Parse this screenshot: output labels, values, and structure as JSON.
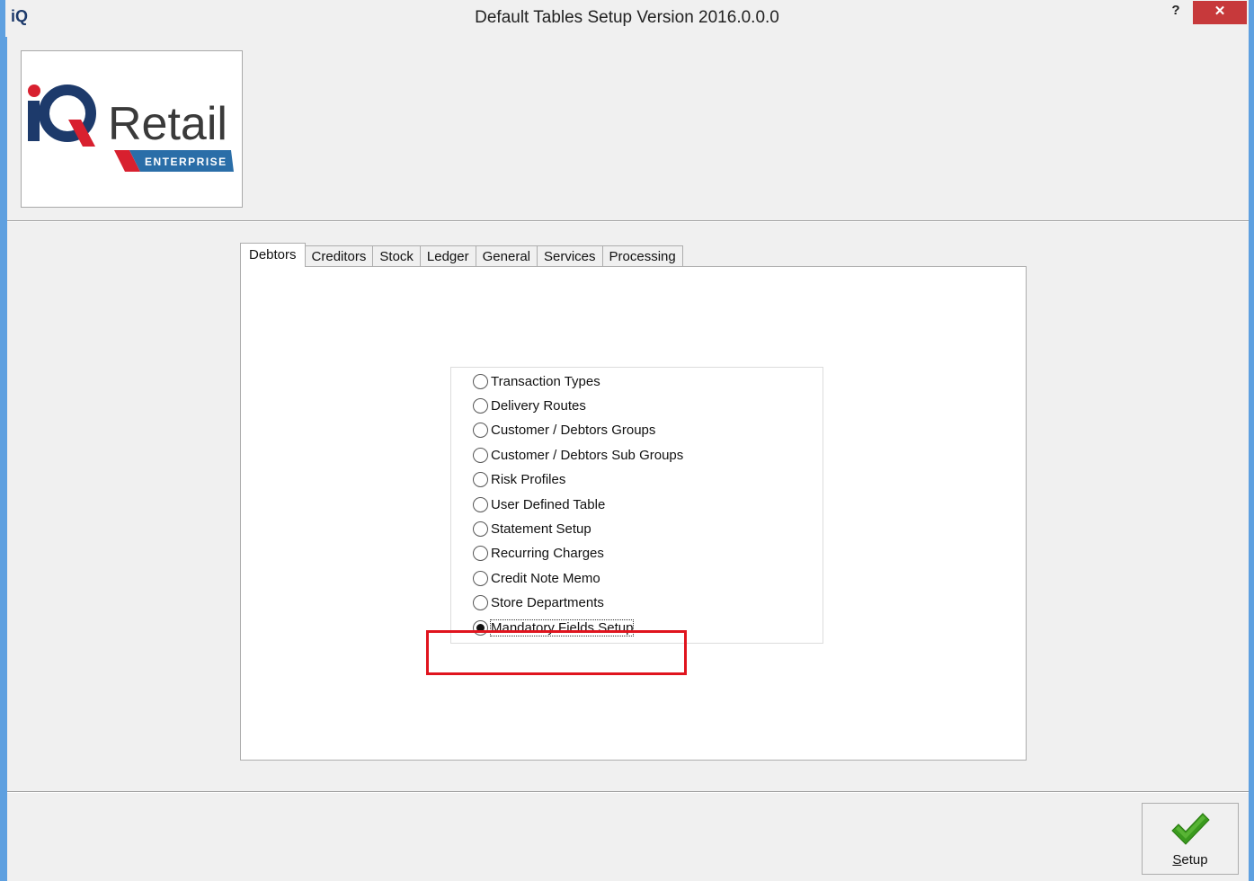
{
  "window": {
    "app_icon": "iQ",
    "title": "Default Tables Setup Version 2016.0.0.0",
    "help_label": "?",
    "close_label": "✕"
  },
  "logo": {
    "brand_prefix": "iQ",
    "brand_name": "Retail",
    "edition": "ENTERPRISE",
    "colors": {
      "navy": "#1d3a6b",
      "red": "#d8202f",
      "grey": "#3a3a3a",
      "blue_band": "#2a6ea8"
    }
  },
  "tabs": [
    {
      "label": "Debtors",
      "active": true
    },
    {
      "label": "Creditors",
      "active": false
    },
    {
      "label": "Stock",
      "active": false
    },
    {
      "label": "Ledger",
      "active": false
    },
    {
      "label": "General",
      "active": false
    },
    {
      "label": "Services",
      "active": false
    },
    {
      "label": "Processing",
      "active": false
    }
  ],
  "options": [
    {
      "label": "Transaction Types",
      "checked": false
    },
    {
      "label": "Delivery Routes",
      "checked": false
    },
    {
      "label": "Customer / Debtors Groups",
      "checked": false
    },
    {
      "label": "Customer / Debtors Sub Groups",
      "checked": false
    },
    {
      "label": "Risk Profiles",
      "checked": false
    },
    {
      "label": "User Defined Table",
      "checked": false
    },
    {
      "label": "Statement Setup",
      "checked": false
    },
    {
      "label": "Recurring Charges",
      "checked": false
    },
    {
      "label": "Credit Note Memo",
      "checked": false
    },
    {
      "label": "Store Departments",
      "checked": false
    },
    {
      "label": "Mandatory Fields Setup",
      "checked": true
    }
  ],
  "footer": {
    "setup_label_mnemonic": "S",
    "setup_label_rest": "etup",
    "check_color": "#3a9a1e"
  },
  "highlight_color": "#e0141e"
}
